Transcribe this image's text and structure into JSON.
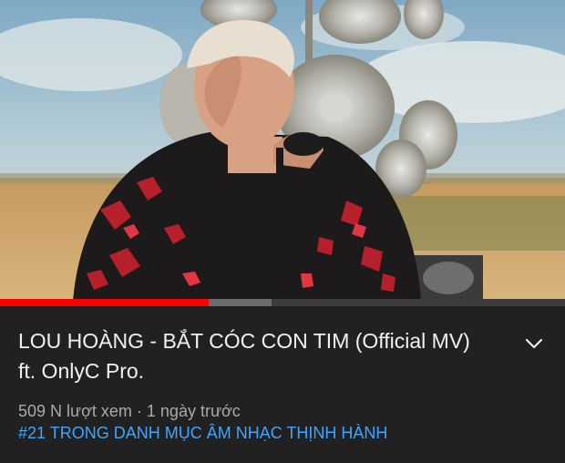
{
  "video": {
    "progress_played": 0.37,
    "progress_buffered": 0.48,
    "progress_color": "#ff0000"
  },
  "details": {
    "title": "LOU HOÀNG - BẮT CÓC CON TIM (Official MV) ft. OnlyC Pro.",
    "views": "509 N lượt xem",
    "separator": " · ",
    "uploaded": "1 ngày trước",
    "trending": "#21 TRONG DANH MỤC ÂM NHẠC THỊNH HÀNH",
    "trending_color": "#3ea6ff",
    "expand_icon": "chevron-down-icon"
  }
}
